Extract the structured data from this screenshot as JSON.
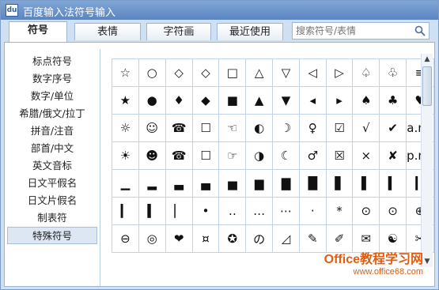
{
  "window": {
    "title": "百度输入法符号输入",
    "icon": "app-icon"
  },
  "tabs": [
    {
      "label": "符号",
      "active": true
    },
    {
      "label": "表情",
      "active": false
    },
    {
      "label": "字符画",
      "active": false
    },
    {
      "label": "最近使用",
      "active": false
    }
  ],
  "search": {
    "placeholder": "搜索符号/表情",
    "icon": "search-icon"
  },
  "sidebar": {
    "items": [
      "标点符号",
      "数字序号",
      "数字/单位",
      "希腊/俄文/拉丁",
      "拼音/注音",
      "部首/中文",
      "英文音标",
      "日文平假名",
      "日文片假名",
      "制表符",
      "特殊符号"
    ],
    "active_index": 10
  },
  "symbols": [
    [
      "☆",
      "○",
      "◇",
      "◇",
      "□",
      "△",
      "▽",
      "◁",
      "▷",
      "♤",
      "♧",
      "≡"
    ],
    [
      "★",
      "●",
      "♦",
      "◆",
      "■",
      "▲",
      "▼",
      "◂",
      "▸",
      "♠",
      "♣",
      "♥"
    ],
    [
      "☼",
      "☺",
      "☎",
      "☐",
      "☜",
      "◐",
      "☽",
      "♀",
      "☑",
      "√",
      "✔",
      "a.m."
    ],
    [
      "☀",
      "☻",
      "☎",
      "☐",
      "☞",
      "◑",
      "☾",
      "♂",
      "☒",
      "×",
      "✘",
      "p.m."
    ],
    [
      "▁",
      "▂",
      "▃",
      "▄",
      "▅",
      "▆",
      "▇",
      "█",
      "▋",
      "▌",
      "▍",
      "▎"
    ],
    [
      "▎",
      "▍",
      "▏",
      "•",
      "‥",
      "…",
      "⋯",
      "·",
      "*",
      "⊙",
      "⊙",
      "⊕"
    ],
    [
      "⊖",
      "◎",
      "❤",
      "¤",
      "✪",
      "の",
      "◿",
      "✎",
      "✐",
      "✉",
      "☯",
      "✂"
    ]
  ],
  "watermark": {
    "logo": "Office教程学习网",
    "url": "www.office68.com"
  }
}
